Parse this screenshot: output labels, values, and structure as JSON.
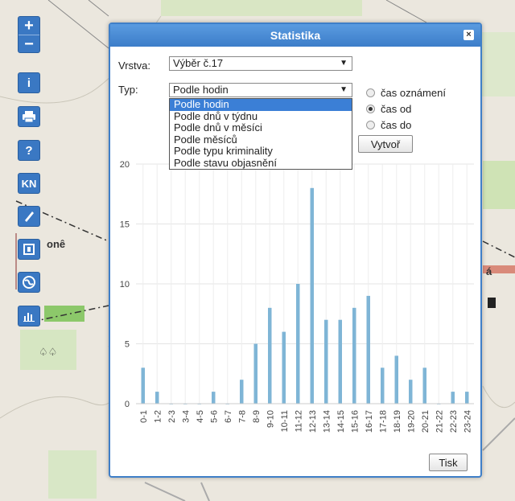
{
  "map": {
    "place_label": "onê",
    "icons": [
      "zoom-in-icon",
      "zoom-out-icon",
      "info-icon",
      "print-icon",
      "help-icon",
      "cadastre-icon",
      "draw-icon",
      "layers-icon",
      "globe-icon",
      "statistics-icon",
      "gas-station-icon"
    ]
  },
  "toolbar": {
    "zoom_in": "+",
    "zoom_out": "−",
    "info": "i",
    "help": "?",
    "kn": "KN"
  },
  "dialog": {
    "title": "Statistika",
    "close": "×",
    "layer_label": "Vrstva:",
    "layer_value": "Výběr č.17",
    "type_label": "Typ:",
    "type_value": "Podle hodin",
    "type_options": [
      "Podle hodin",
      "Podle dnů v týdnu",
      "Podle dnů v měsíci",
      "Podle měsíců",
      "Podle typu kriminality",
      "Podle stavu objasnění"
    ],
    "radio_options": [
      {
        "label": "čas oznámení",
        "checked": false
      },
      {
        "label": "čas od",
        "checked": true
      },
      {
        "label": "čas do",
        "checked": false
      }
    ],
    "create_button": "Vytvoř",
    "print_button": "Tisk"
  },
  "chart_data": {
    "type": "bar",
    "categories": [
      "0-1",
      "1-2",
      "2-3",
      "3-4",
      "4-5",
      "5-6",
      "6-7",
      "7-8",
      "8-9",
      "9-10",
      "10-11",
      "11-12",
      "12-13",
      "13-14",
      "14-15",
      "15-16",
      "16-17",
      "17-18",
      "18-19",
      "19-20",
      "20-21",
      "21-22",
      "22-23",
      "23-24"
    ],
    "values": [
      3,
      1,
      0,
      0,
      0,
      1,
      0,
      2,
      5,
      8,
      6,
      10,
      18,
      7,
      7,
      8,
      9,
      3,
      4,
      2,
      3,
      0,
      1,
      1
    ],
    "y_ticks": [
      "0",
      "5",
      "10",
      "15",
      "20"
    ],
    "ylim": [
      0,
      20
    ],
    "grid": true,
    "bar_color": "#7fb5d6"
  }
}
